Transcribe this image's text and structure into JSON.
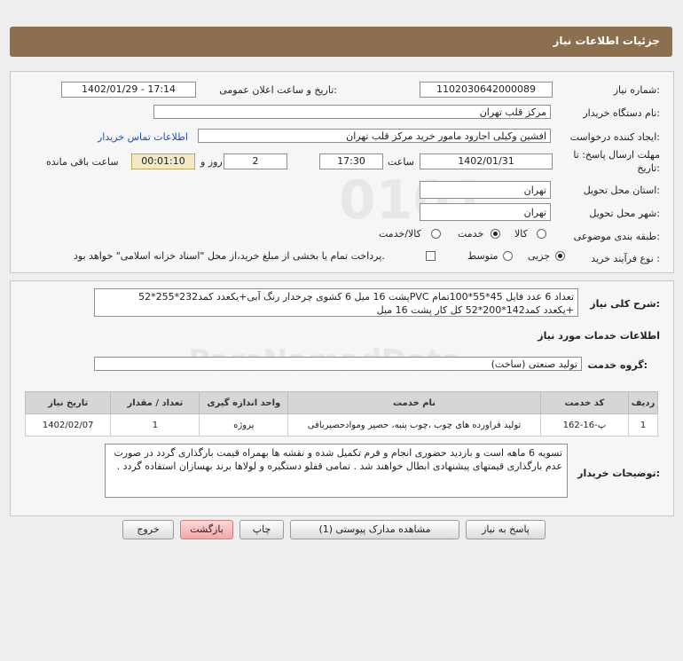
{
  "header": {
    "title": "جزئیات اطلاعات نیاز"
  },
  "form": {
    "need_number_label": "شماره نیاز:",
    "need_number": "1102030642000089",
    "announce_label": "تاریخ و ساعت اعلان عمومی:",
    "announce_value": "1402/01/29 - 17:14",
    "buyer_org_label": "نام دستگاه خریدار:",
    "buyer_org": "مرکز قلب تهران",
    "requester_label": "ایجاد کننده درخواست:",
    "requester": "افشین وکیلی اجارود مامور خرید مرکز قلب تهران",
    "contact_link": "اطلاعات تماس خریدار",
    "deadline_label": "مهلت ارسال پاسخ: تا",
    "deadline_label2": "تاریخ:",
    "deadline_date": "1402/01/31",
    "time_label": "ساعت",
    "deadline_time": "17:30",
    "days_count": "2",
    "days_label": "روز و",
    "remaining_time": "00:01:10",
    "remaining_label": "ساعت باقی مانده",
    "province_label": "استان محل تحویل:",
    "province": "تهران",
    "city_label": "شهر محل تحویل:",
    "city": "تهران",
    "category_label": "طبقه بندی موضوعی:",
    "category_options": [
      "کالا",
      "خدمت",
      "کالا/خدمت"
    ],
    "category_selected": "خدمت",
    "process_label": "نوع فرآیند خرید :",
    "process_options": [
      "جزیی",
      "متوسط"
    ],
    "process_selected": "جزیی",
    "treasury_note": "پرداخت تمام یا بخشی از مبلغ خرید،از محل \"اسناد خزانه اسلامی\" خواهد بود."
  },
  "description": {
    "label": "شرح کلی نیاز:",
    "line1": "تعداد 6 عدد فایل 45*55*100تمام PVCپشت 16 میل 6 کشوی چرخدار رنگ آبی+یکعدد کمد232*255*52",
    "line2": "+یکعدد کمد142*200*52 کل کار پشت 16 میل"
  },
  "services": {
    "section_title": "اطلاعات خدمات مورد نیاز",
    "group_label": "گروه خدمت:",
    "group_value": "تولید صنعتی (ساخت)",
    "table": {
      "headers": [
        "ردیف",
        "کد خدمت",
        "نام خدمت",
        "واحد اندازه گیری",
        "تعداد / مقدار",
        "تاریخ نیاز"
      ],
      "rows": [
        [
          "1",
          "پ-16-162",
          "تولید فراورده های چوب ،چوب پنبه، حصیر وموادحصیربافی",
          "پروژه",
          "1",
          "1402/02/07"
        ]
      ]
    }
  },
  "buyer_notes": {
    "label": "توضیحات خریدار:",
    "text": "تسویه 6 ماهه است و بازدید حضوری انجام و فرم تکمیل شده و نقشه ها بهمراه قیمت بارگذاری گردد در صورت عدم بارگذاری قیمتهای پیشنهادی ابطال خواهند شد . تمامی قفلو دستگیره و لولاها برند بهسازان استفاده گردد ."
  },
  "buttons": {
    "reply": "پاسخ به نیاز",
    "view_docs": "مشاهده مدارک پیوستی (1)",
    "print": "چاپ",
    "back": "بازگشت",
    "exit": "خروج"
  },
  "colors": {
    "header_bg": "#8b6f4e",
    "link": "#1a4fb8",
    "exit_button": "#f0a8a8"
  }
}
